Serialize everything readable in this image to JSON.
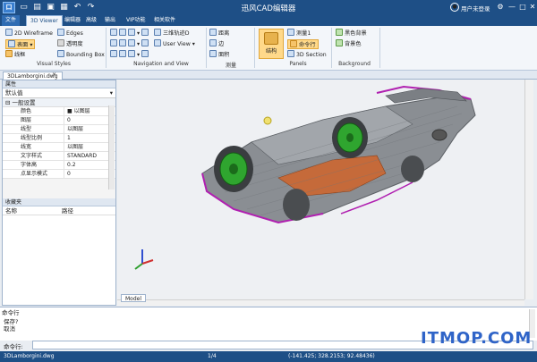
{
  "window": {
    "app_icon": "口",
    "title": "迅风CAD编辑器",
    "user_label": "用户未登录",
    "controls": [
      "settings-icon",
      "minimize-icon",
      "maximize-icon",
      "close-icon"
    ]
  },
  "tabs": [
    "文件",
    "3D Viewer",
    "编辑器",
    "高级",
    "输出",
    "VIP功能",
    "相关软件"
  ],
  "active_tab": "3D Viewer",
  "ribbon": {
    "visual_styles": {
      "label": "Visual Styles",
      "items": [
        "2D Wireframe",
        "表面",
        "线框",
        "Edges",
        "透明度",
        "Bounding Box"
      ]
    },
    "navigation": {
      "label": "Navigation and View",
      "items": [
        "三维轨迹D",
        "User View"
      ]
    },
    "measure": {
      "label": "测量",
      "items": [
        "距离",
        "边",
        "面积"
      ]
    },
    "panels": {
      "label": "Panels",
      "big_button": "结构",
      "items": [
        "测量1",
        "命令行",
        "3D Section"
      ]
    },
    "background": {
      "label": "Background",
      "items": [
        "黑色背景",
        "背景色"
      ]
    }
  },
  "file_tab": "3DLamborgini.dwg",
  "properties": {
    "title": "属性",
    "dropdown": "默认值",
    "section": "一般设置",
    "rows": [
      {
        "k": "颜色",
        "v": "■ 以图层"
      },
      {
        "k": "图层",
        "v": "0"
      },
      {
        "k": "线型",
        "v": "以图层"
      },
      {
        "k": "线型比例",
        "v": "1"
      },
      {
        "k": "线宽",
        "v": "以图层"
      },
      {
        "k": "文字样式",
        "v": "STANDARD"
      },
      {
        "k": "字体高",
        "v": "0.2"
      },
      {
        "k": "点显示模式",
        "v": "0"
      }
    ]
  },
  "favorites": {
    "title": "收藏夹",
    "col_name": "名称",
    "col_path": "路径"
  },
  "viewport": {
    "model_tab": "Model",
    "colors": {
      "body": "#8a8e93",
      "wheels": "#2fa52f",
      "accent": "#b020b0",
      "interior": "#c56a3a"
    }
  },
  "command": {
    "header": "命令行",
    "lines": [
      "保存?",
      "取消"
    ],
    "input_label": "命令行:",
    "input_value": ""
  },
  "status": {
    "file": "3DLamborgini.dwg",
    "page": "1/4",
    "coords": "(-141.425; 328.2153; 92.48436)"
  },
  "watermark": "ITMOP.COM"
}
